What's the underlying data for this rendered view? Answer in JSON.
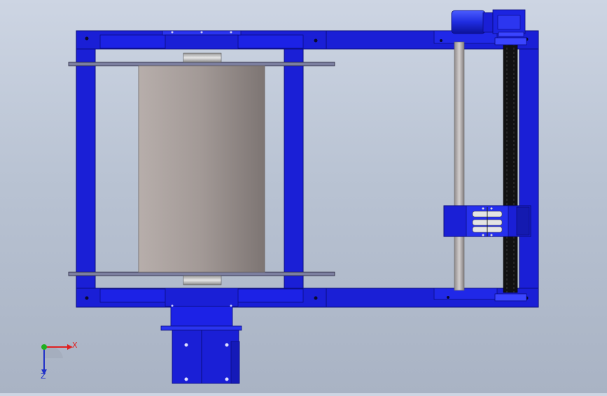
{
  "colors": {
    "frame": "#1a1fd6",
    "frame_dark": "#0d109a",
    "frame_light": "#3b44ff",
    "drum": "#a39a98",
    "chain": "#111111",
    "axis_x": "#e02020",
    "axis_y": "#20b020",
    "axis_z": "#2030c8"
  },
  "triad": {
    "x_label": "X",
    "z_label": "Z"
  },
  "icons": [
    "coordinate-triad-icon"
  ]
}
